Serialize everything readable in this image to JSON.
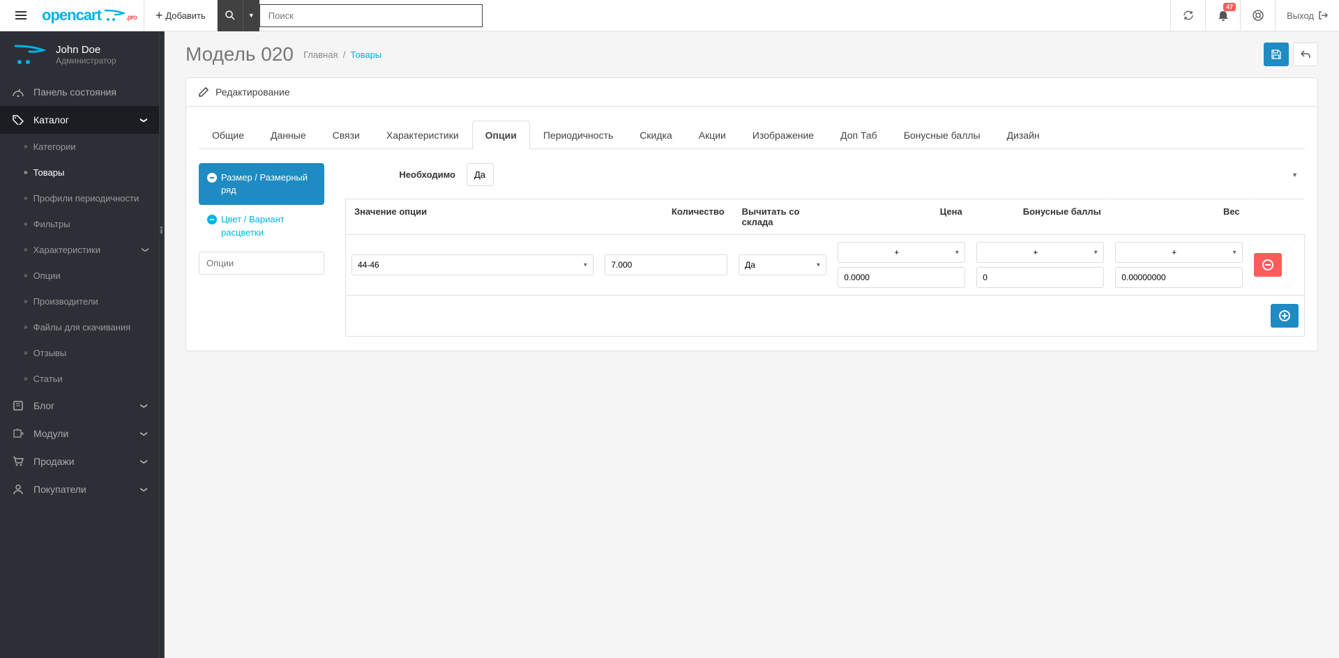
{
  "header": {
    "logo_text": "opencart",
    "logo_suffix": ".pro",
    "add_label": "Добавить",
    "search_placeholder": "Поиск",
    "notif_count": "47",
    "logout_label": "Выход"
  },
  "profile": {
    "name": "John Doe",
    "role": "Администратор"
  },
  "sidebar": {
    "dashboard": "Панель состояния",
    "catalog": "Каталог",
    "catalog_items": {
      "categories": "Категории",
      "products": "Товары",
      "recurring": "Профили периодичности",
      "filters": "Фильтры",
      "attributes": "Характеристики",
      "options": "Опции",
      "manufacturers": "Производители",
      "downloads": "Файлы для скачивания",
      "reviews": "Отзывы",
      "articles": "Статьи"
    },
    "blog": "Блог",
    "modules": "Модули",
    "sales": "Продажи",
    "customers": "Покупатели"
  },
  "page": {
    "title": "Модель 020",
    "crumb_home": "Главная",
    "crumb_products": "Товары",
    "panel_title": "Редактирование"
  },
  "tabs": {
    "general": "Общие",
    "data": "Данные",
    "links": "Связи",
    "attribute": "Характеристики",
    "option": "Опции",
    "recurring": "Периодичность",
    "discount": "Скидка",
    "special": "Акции",
    "image": "Изображение",
    "doptab": "Доп Таб",
    "reward": "Бонусные баллы",
    "design": "Дизайн"
  },
  "options": {
    "nav_size": "Размер / Размерный ряд",
    "nav_color": "Цвет / Вариант расцветки",
    "options_placeholder": "Опции",
    "required_label": "Необходимо",
    "required_value": "Да",
    "th_value": "Значение опции",
    "th_qty": "Количество",
    "th_subtract": "Вычитать со склада",
    "th_price": "Цена",
    "th_points": "Бонусные баллы",
    "th_weight": "Вес",
    "row": {
      "value": "44-46",
      "qty": "7.000",
      "subtract": "Да",
      "price_sign": "+",
      "price": "0.0000",
      "points_sign": "+",
      "points": "0",
      "weight_sign": "+",
      "weight": "0.00000000"
    }
  }
}
